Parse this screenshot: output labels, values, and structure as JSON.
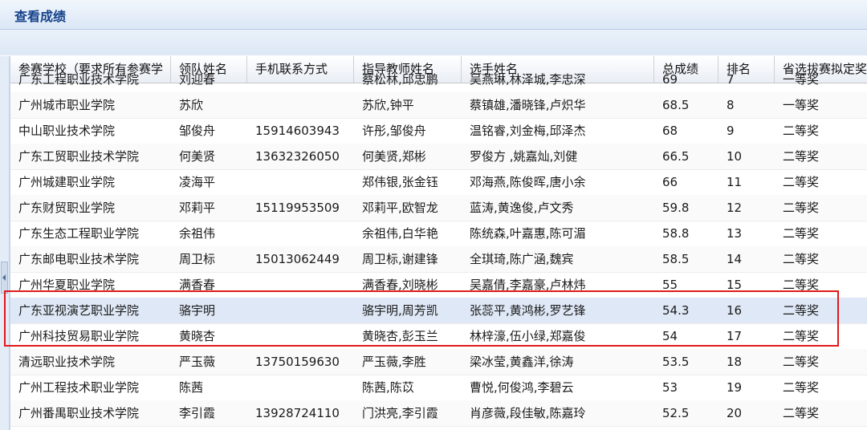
{
  "window": {
    "title": "查看成绩"
  },
  "table": {
    "columns": [
      "参赛学校（要求所有参赛学",
      "领队姓名",
      "手机联系方式",
      "指导教师姓名",
      "选手姓名",
      "总成绩",
      "排名",
      "省选拔赛拟定奖"
    ],
    "rows": [
      [
        "广东工程职业技术学院",
        "刘迎春",
        "",
        "蔡松林,邱忠鹏",
        "吴燕琳,林泽城,李忠深",
        "69",
        "7",
        "一等奖"
      ],
      [
        "广州城市职业学院",
        "苏欣",
        "",
        "苏欣,钟平",
        "蔡镇雄,潘晓锋,卢炽华",
        "68.5",
        "8",
        "一等奖"
      ],
      [
        "中山职业技术学院",
        "邹俊舟",
        "15914603943",
        "许彤,邹俊舟",
        "温铭睿,刘金梅,邱泽杰",
        "68",
        "9",
        "二等奖"
      ],
      [
        "广东工贸职业技术学院",
        "何美贤",
        "13632326050",
        "何美贤,郑彬",
        "罗俊方 ,姚嘉灿,刘健",
        "66.5",
        "10",
        "二等奖"
      ],
      [
        "广州城建职业学院",
        "凌海平",
        "",
        "郑伟银,张金钰",
        "邓海燕,陈俊晖,唐小余",
        "66",
        "11",
        "二等奖"
      ],
      [
        "广东财贸职业学院",
        "邓莉平",
        "15119953509",
        "邓莉平,欧智龙",
        "蓝涛,黄逸俊,卢文秀",
        "59.8",
        "12",
        "二等奖"
      ],
      [
        "广东生态工程职业学院",
        "余祖伟",
        "",
        "余祖伟,白华艳",
        "陈统森,叶嘉惠,陈可湄",
        "58.8",
        "13",
        "二等奖"
      ],
      [
        "广东邮电职业技术学院",
        "周卫标",
        "15013062449",
        "周卫标,谢建锋",
        "全琪琦,陈广涵,魏宾",
        "58.5",
        "14",
        "二等奖"
      ],
      [
        "广州华夏职业学院",
        "满香春",
        "",
        "满香春,刘晓彬",
        "吴嘉倩,李嘉豪,卢林炜",
        "55",
        "15",
        "二等奖"
      ],
      [
        "广东亚视演艺职业学院",
        "骆宇明",
        "",
        "骆宇明,周芳凯",
        "张蕊平,黄鸿彬,罗艺锋",
        "54.3",
        "16",
        "二等奖"
      ],
      [
        "广州科技贸易职业学院",
        "黄晓杏",
        "",
        "黄晓杏,彭玉兰",
        "林梓濠,伍小绿,郑嘉俊",
        "54",
        "17",
        "二等奖"
      ],
      [
        "清远职业技术学院",
        "严玉薇",
        "13750159630",
        "严玉薇,李胜",
        "梁冰莹,黄鑫洋,徐涛",
        "53.5",
        "18",
        "二等奖"
      ],
      [
        "广州工程技术职业学院",
        "陈茜",
        "",
        "陈茜,陈苡",
        "曹悦,何俊鸿,李碧云",
        "53",
        "19",
        "二等奖"
      ],
      [
        "广州番禺职业技术学院",
        "李引霞",
        "13928724110",
        "门洪亮,李引霞",
        "肖彦薇,段佳敏,陈嘉玲",
        "52.5",
        "20",
        "二等奖"
      ]
    ]
  }
}
